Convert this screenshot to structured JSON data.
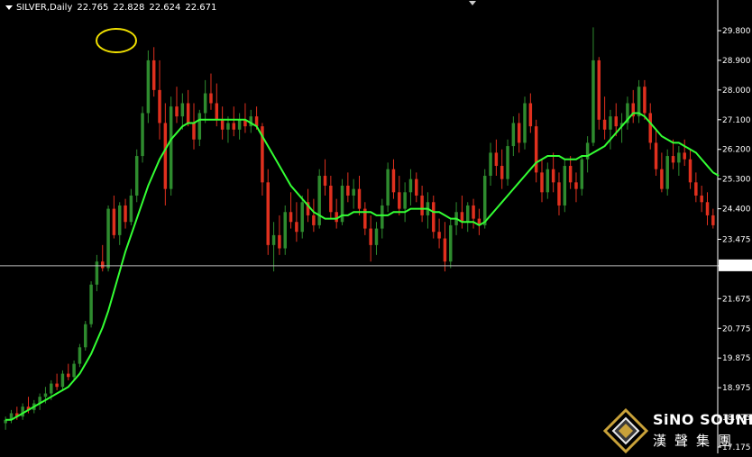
{
  "header": {
    "symbol": "SILVER,Daily",
    "open": "22.765",
    "high": "22.828",
    "low": "22.624",
    "close": "22.671"
  },
  "logo": {
    "name": "SiNO SOUND",
    "chinese": "漢聲集團"
  },
  "colors": {
    "background": "#000000",
    "bull_candle": "#2e8b2e",
    "bear_candle": "#e0301e",
    "moving_average": "#33ff33",
    "price_line": "#bbbbbb",
    "highlight_circle": "#f0e000",
    "text": "#ffffff"
  },
  "chart_data": {
    "type": "candlestick",
    "symbol": "SILVER",
    "timeframe": "Daily",
    "ylim": [
      17.175,
      30.25
    ],
    "y_ticks": [
      "29.800",
      "28.900",
      "28.000",
      "27.100",
      "26.200",
      "25.300",
      "24.400",
      "23.475",
      "22.671",
      "21.675",
      "20.775",
      "19.875",
      "18.975",
      "18.075",
      "17.175"
    ],
    "current_price": 22.671,
    "highlight": "yellow circle around peak near 29.2",
    "candles": [
      [
        17.9,
        18.1,
        17.7,
        18.0
      ],
      [
        18.0,
        18.3,
        17.9,
        18.2
      ],
      [
        18.2,
        18.4,
        18.0,
        18.1
      ],
      [
        18.1,
        18.5,
        18.0,
        18.4
      ],
      [
        18.4,
        18.7,
        18.2,
        18.3
      ],
      [
        18.3,
        18.6,
        18.2,
        18.5
      ],
      [
        18.5,
        18.8,
        18.3,
        18.7
      ],
      [
        18.7,
        19.0,
        18.5,
        18.8
      ],
      [
        18.8,
        19.2,
        18.6,
        19.1
      ],
      [
        19.1,
        19.4,
        18.9,
        19.0
      ],
      [
        19.0,
        19.5,
        18.9,
        19.4
      ],
      [
        19.4,
        19.7,
        19.2,
        19.3
      ],
      [
        19.3,
        19.8,
        19.2,
        19.7
      ],
      [
        19.7,
        20.3,
        19.6,
        20.2
      ],
      [
        20.2,
        21.0,
        20.1,
        20.9
      ],
      [
        20.9,
        22.2,
        20.8,
        22.1
      ],
      [
        22.1,
        23.0,
        21.9,
        22.8
      ],
      [
        22.8,
        23.3,
        22.5,
        22.6
      ],
      [
        22.6,
        24.5,
        22.5,
        24.4
      ],
      [
        24.4,
        24.8,
        23.5,
        23.6
      ],
      [
        23.6,
        24.6,
        23.3,
        24.5
      ],
      [
        24.5,
        24.7,
        23.8,
        24.0
      ],
      [
        24.0,
        25.0,
        23.9,
        24.8
      ],
      [
        24.8,
        26.2,
        24.6,
        26.0
      ],
      [
        26.0,
        27.5,
        25.8,
        27.3
      ],
      [
        27.3,
        29.2,
        27.0,
        28.9
      ],
      [
        28.9,
        29.3,
        27.8,
        28.0
      ],
      [
        28.0,
        28.9,
        26.5,
        27.0
      ],
      [
        27.0,
        27.6,
        24.5,
        25.0
      ],
      [
        25.0,
        27.8,
        24.8,
        27.5
      ],
      [
        27.5,
        28.1,
        27.0,
        27.2
      ],
      [
        27.2,
        27.9,
        26.8,
        27.6
      ],
      [
        27.6,
        28.0,
        26.9,
        27.0
      ],
      [
        27.0,
        27.6,
        26.2,
        26.5
      ],
      [
        26.5,
        27.4,
        26.3,
        27.3
      ],
      [
        27.3,
        28.3,
        27.0,
        27.9
      ],
      [
        27.9,
        28.5,
        27.4,
        27.6
      ],
      [
        27.6,
        28.2,
        26.9,
        27.1
      ],
      [
        27.1,
        27.5,
        26.5,
        26.8
      ],
      [
        26.8,
        27.2,
        26.4,
        27.0
      ],
      [
        27.0,
        27.5,
        26.6,
        26.8
      ],
      [
        26.8,
        27.3,
        26.5,
        27.1
      ],
      [
        27.1,
        27.6,
        26.7,
        26.9
      ],
      [
        26.9,
        27.4,
        26.7,
        27.2
      ],
      [
        27.2,
        27.5,
        26.8,
        26.9
      ],
      [
        26.9,
        27.0,
        24.8,
        25.2
      ],
      [
        25.2,
        25.6,
        23.0,
        23.3
      ],
      [
        23.3,
        24.0,
        22.5,
        23.6
      ],
      [
        23.6,
        24.2,
        23.0,
        23.2
      ],
      [
        23.2,
        24.5,
        23.0,
        24.3
      ],
      [
        24.3,
        24.9,
        23.8,
        24.0
      ],
      [
        24.0,
        24.6,
        23.4,
        23.7
      ],
      [
        23.7,
        24.8,
        23.5,
        24.6
      ],
      [
        24.6,
        25.0,
        24.0,
        24.2
      ],
      [
        24.2,
        24.7,
        23.7,
        23.9
      ],
      [
        23.9,
        25.6,
        23.8,
        25.4
      ],
      [
        25.4,
        25.9,
        24.8,
        25.1
      ],
      [
        25.1,
        25.4,
        24.1,
        24.3
      ],
      [
        24.3,
        24.7,
        23.8,
        24.0
      ],
      [
        24.0,
        25.3,
        23.9,
        25.1
      ],
      [
        25.1,
        25.5,
        24.6,
        24.8
      ],
      [
        24.8,
        25.3,
        24.4,
        25.0
      ],
      [
        25.0,
        25.4,
        24.2,
        24.4
      ],
      [
        24.4,
        24.6,
        23.6,
        23.8
      ],
      [
        23.8,
        24.2,
        22.8,
        23.3
      ],
      [
        23.3,
        24.0,
        23.0,
        23.8
      ],
      [
        23.8,
        24.7,
        23.5,
        24.5
      ],
      [
        24.5,
        25.8,
        24.3,
        25.6
      ],
      [
        25.6,
        25.9,
        24.7,
        24.9
      ],
      [
        24.9,
        25.4,
        24.2,
        24.4
      ],
      [
        24.4,
        25.2,
        24.0,
        24.9
      ],
      [
        24.9,
        25.6,
        24.5,
        25.3
      ],
      [
        25.3,
        25.5,
        24.6,
        24.8
      ],
      [
        24.8,
        25.1,
        24.0,
        24.2
      ],
      [
        24.2,
        24.9,
        23.8,
        24.6
      ],
      [
        24.6,
        24.8,
        23.5,
        23.7
      ],
      [
        23.7,
        24.1,
        23.2,
        23.5
      ],
      [
        23.5,
        24.0,
        22.5,
        22.8
      ],
      [
        22.8,
        24.1,
        22.6,
        23.9
      ],
      [
        23.9,
        24.6,
        23.6,
        24.3
      ],
      [
        24.3,
        24.8,
        23.8,
        24.0
      ],
      [
        24.0,
        24.6,
        23.7,
        24.5
      ],
      [
        24.5,
        24.7,
        23.8,
        24.1
      ],
      [
        24.1,
        24.4,
        23.6,
        23.9
      ],
      [
        23.9,
        25.6,
        23.8,
        25.4
      ],
      [
        25.4,
        26.4,
        25.1,
        26.1
      ],
      [
        26.1,
        26.5,
        25.4,
        25.7
      ],
      [
        25.7,
        26.2,
        25.0,
        25.3
      ],
      [
        25.3,
        26.5,
        25.1,
        26.3
      ],
      [
        26.3,
        27.2,
        26.0,
        27.0
      ],
      [
        27.0,
        27.3,
        26.1,
        26.4
      ],
      [
        26.4,
        27.8,
        26.2,
        27.6
      ],
      [
        27.6,
        27.9,
        26.7,
        26.9
      ],
      [
        26.9,
        27.1,
        25.2,
        25.5
      ],
      [
        25.5,
        25.9,
        24.6,
        24.9
      ],
      [
        24.9,
        25.8,
        24.7,
        25.6
      ],
      [
        25.6,
        26.1,
        24.9,
        25.2
      ],
      [
        25.2,
        25.5,
        24.2,
        24.5
      ],
      [
        24.5,
        25.9,
        24.3,
        25.7
      ],
      [
        25.7,
        26.0,
        25.0,
        25.2
      ],
      [
        25.2,
        25.5,
        24.6,
        25.0
      ],
      [
        25.0,
        26.0,
        24.8,
        25.9
      ],
      [
        25.9,
        26.6,
        25.5,
        26.4
      ],
      [
        26.4,
        29.9,
        26.3,
        28.9
      ],
      [
        28.9,
        29.0,
        26.8,
        27.1
      ],
      [
        27.1,
        27.8,
        26.5,
        26.8
      ],
      [
        26.8,
        27.4,
        26.2,
        27.2
      ],
      [
        27.2,
        27.6,
        26.6,
        26.9
      ],
      [
        26.9,
        27.3,
        26.4,
        27.0
      ],
      [
        27.0,
        27.8,
        26.8,
        27.6
      ],
      [
        27.6,
        28.0,
        27.0,
        27.2
      ],
      [
        27.2,
        28.3,
        27.0,
        28.1
      ],
      [
        28.1,
        28.3,
        27.1,
        27.3
      ],
      [
        27.3,
        27.6,
        26.2,
        26.4
      ],
      [
        26.4,
        26.8,
        25.4,
        25.6
      ],
      [
        25.6,
        26.1,
        24.9,
        25.0
      ],
      [
        25.0,
        26.2,
        24.8,
        26.0
      ],
      [
        26.0,
        26.5,
        25.6,
        25.8
      ],
      [
        25.8,
        26.3,
        25.4,
        26.1
      ],
      [
        26.1,
        26.5,
        25.7,
        25.9
      ],
      [
        25.9,
        26.2,
        25.0,
        25.2
      ],
      [
        25.2,
        25.5,
        24.6,
        24.8
      ],
      [
        24.8,
        25.1,
        24.3,
        24.6
      ],
      [
        24.6,
        24.9,
        23.9,
        24.2
      ],
      [
        24.2,
        24.4,
        23.8,
        23.9
      ]
    ],
    "moving_average": [
      18.0,
      18.0,
      18.1,
      18.2,
      18.3,
      18.4,
      18.5,
      18.6,
      18.7,
      18.8,
      18.9,
      19.0,
      19.2,
      19.4,
      19.7,
      20.0,
      20.4,
      20.8,
      21.3,
      21.9,
      22.5,
      23.1,
      23.6,
      24.1,
      24.6,
      25.1,
      25.5,
      25.9,
      26.2,
      26.5,
      26.7,
      26.9,
      27.0,
      27.0,
      27.1,
      27.1,
      27.1,
      27.1,
      27.1,
      27.1,
      27.1,
      27.1,
      27.1,
      27.0,
      26.9,
      26.6,
      26.3,
      26.0,
      25.7,
      25.4,
      25.1,
      24.9,
      24.7,
      24.5,
      24.3,
      24.2,
      24.1,
      24.1,
      24.1,
      24.2,
      24.2,
      24.3,
      24.3,
      24.3,
      24.3,
      24.2,
      24.2,
      24.2,
      24.3,
      24.3,
      24.3,
      24.4,
      24.4,
      24.4,
      24.4,
      24.3,
      24.3,
      24.2,
      24.1,
      24.1,
      24.0,
      24.0,
      24.0,
      23.9,
      24.0,
      24.2,
      24.4,
      24.6,
      24.8,
      25.0,
      25.2,
      25.4,
      25.6,
      25.8,
      25.9,
      26.0,
      26.0,
      26.0,
      25.9,
      25.9,
      25.9,
      26.0,
      26.0,
      26.1,
      26.2,
      26.3,
      26.5,
      26.7,
      26.9,
      27.1,
      27.3,
      27.3,
      27.2,
      27.0,
      26.8,
      26.6,
      26.5,
      26.4,
      26.4,
      26.3,
      26.2,
      26.1,
      25.9,
      25.7,
      25.5,
      25.4
    ]
  }
}
